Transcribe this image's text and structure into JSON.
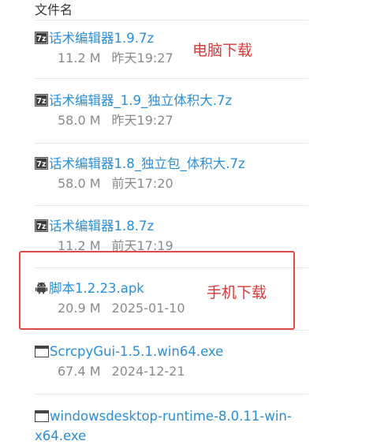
{
  "header": {
    "column_title": "文件名"
  },
  "files": [
    {
      "name": "话术编辑器1.9.7z",
      "size": "11.2 M",
      "date": "昨天19:27",
      "icon": "archive-7z-icon"
    },
    {
      "name": "话术编辑器_1.9_独立体积大.7z",
      "size": "58.0 M",
      "date": "昨天19:27",
      "icon": "archive-7z-icon"
    },
    {
      "name": "话术编辑器1.8_独立包_体积大.7z",
      "size": "58.0 M",
      "date": "前天17:20",
      "icon": "archive-7z-icon"
    },
    {
      "name": "话术编辑器1.8.7z",
      "size": "11.2 M",
      "date": "前天17:19",
      "icon": "archive-7z-icon"
    },
    {
      "name": "脚本1.2.23.apk",
      "size": "20.9 M",
      "date": "2025-01-10",
      "icon": "android-icon"
    },
    {
      "name": "ScrcpyGui-1.5.1.win64.exe",
      "size": "67.4 M",
      "date": "2024-12-21",
      "icon": "window-exe-icon"
    },
    {
      "name": "windowsdesktop-runtime-8.0.11-win-x64.exe",
      "size": "",
      "date": "",
      "icon": "window-exe-icon"
    }
  ],
  "annotations": {
    "pc_download": "电脑下载",
    "mobile_download": "手机下载",
    "color": "#e03535"
  },
  "colors": {
    "link": "#2a8ed9",
    "meta": "#8a8a8a",
    "highlight_border": "#e04a46"
  }
}
